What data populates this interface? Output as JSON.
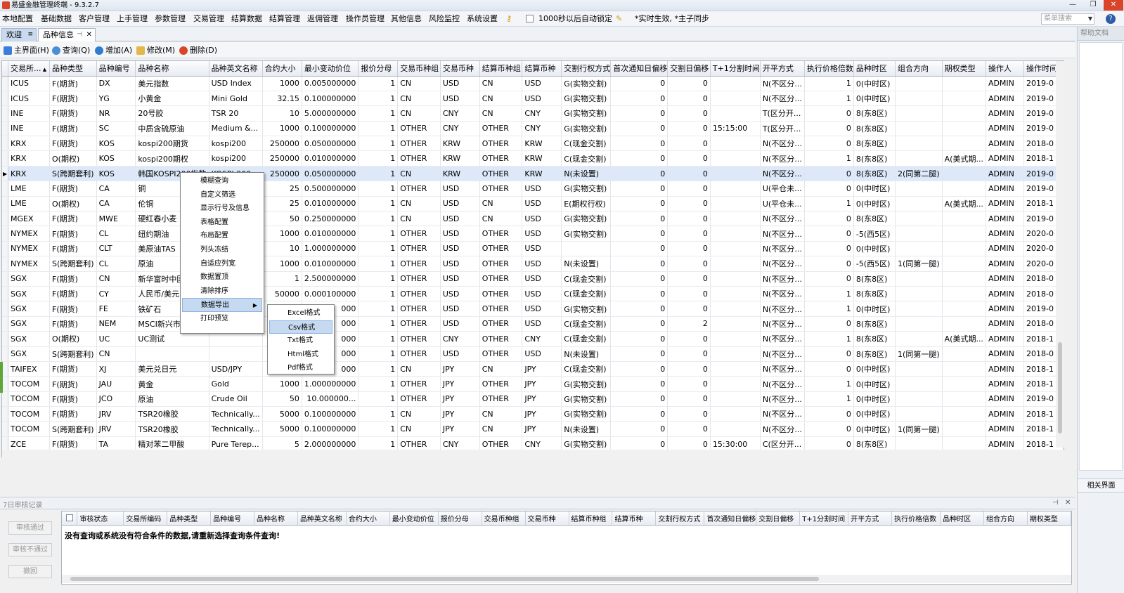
{
  "window": {
    "title": "易盛金融管理终端 - 9.3.2.7",
    "controls": [
      "—",
      "❐",
      "✕"
    ]
  },
  "menu": {
    "items": [
      "本地配置",
      "基础数据",
      "客户管理",
      "上手管理",
      "参数管理",
      "交易管理",
      "结算数据",
      "结算管理",
      "返佣管理",
      "操作员管理",
      "其他信息",
      "风险监控",
      "系统设置"
    ],
    "lock_label": "1000秒以后自动锁定",
    "notice": "*实时生效, *主子同步",
    "search_placeholder": "菜单搜索",
    "help": "?"
  },
  "tabs": [
    {
      "label": "欢迎"
    },
    {
      "label": "品种信息"
    }
  ],
  "toolbar": {
    "home": "主界面(H)",
    "query": "查询(Q)",
    "add": "增加(A)",
    "edit": "修改(M)",
    "delete": "删除(D)"
  },
  "grid": {
    "columns": [
      "交易所...",
      "品种类型",
      "品种编号",
      "品种名称",
      "品种英文名称",
      "合约大小",
      "最小变动价位",
      "报价分母",
      "交易币种组",
      "交易币种",
      "结算币种组",
      "结算币种",
      "交割行权方式",
      "首次通知日偏移",
      "交割日偏移",
      "T+1分割时间",
      "开平方式",
      "执行价格倍数",
      "品种时区",
      "组合方向",
      "期权类型",
      "操作人",
      "操作时间"
    ],
    "rows": [
      [
        "ICUS",
        "F(期货)",
        "DX",
        "美元指数",
        "USD Index",
        "1000",
        "0.005000000",
        "1",
        "CN",
        "USD",
        "CN",
        "USD",
        "G(实物交割)",
        "0",
        "0",
        "",
        "N(不区分...",
        "1",
        "0(中时区)",
        "",
        "",
        "ADMIN",
        "2019-0"
      ],
      [
        "ICUS",
        "F(期货)",
        "YG",
        "小黄金",
        "Mini Gold",
        "32.15",
        "0.100000000",
        "1",
        "CN",
        "USD",
        "CN",
        "USD",
        "G(实物交割)",
        "0",
        "0",
        "",
        "N(不区分...",
        "1",
        "0(中时区)",
        "",
        "",
        "ADMIN",
        "2019-0"
      ],
      [
        "INE",
        "F(期货)",
        "NR",
        "20号胶",
        "TSR 20",
        "10",
        "5.000000000",
        "1",
        "CN",
        "CNY",
        "CN",
        "CNY",
        "G(实物交割)",
        "0",
        "0",
        "",
        "T(区分开...",
        "0",
        "8(东8区)",
        "",
        "",
        "ADMIN",
        "2019-0"
      ],
      [
        "INE",
        "F(期货)",
        "SC",
        "中质含硫原油",
        "Medium &...",
        "1000",
        "0.100000000",
        "1",
        "OTHER",
        "CNY",
        "OTHER",
        "CNY",
        "G(实物交割)",
        "0",
        "0",
        "15:15:00",
        "T(区分开...",
        "0",
        "8(东8区)",
        "",
        "",
        "ADMIN",
        "2019-0"
      ],
      [
        "KRX",
        "F(期货)",
        "KOS",
        "kospi200期货",
        "kospi200",
        "250000",
        "0.050000000",
        "1",
        "OTHER",
        "KRW",
        "OTHER",
        "KRW",
        "C(现金交割)",
        "0",
        "0",
        "",
        "N(不区分...",
        "0",
        "8(东8区)",
        "",
        "",
        "ADMIN",
        "2018-0"
      ],
      [
        "KRX",
        "O(期权)",
        "KOS",
        "kospi200期权",
        "kospi200",
        "250000",
        "0.010000000",
        "1",
        "OTHER",
        "KRW",
        "OTHER",
        "KRW",
        "C(现金交割)",
        "0",
        "0",
        "",
        "N(不区分...",
        "1",
        "8(东8区)",
        "",
        "A(美式期...",
        "ADMIN",
        "2018-1"
      ],
      [
        "KRX",
        "S(跨期套利)",
        "KOS",
        "韩国KOSPI200指数",
        "KOSPI 200",
        "250000",
        "0.050000000",
        "1",
        "CN",
        "KRW",
        "OTHER",
        "KRW",
        "N(未设置)",
        "0",
        "0",
        "",
        "N(不区分...",
        "0",
        "8(东8区)",
        "2(同第二腿)",
        "",
        "ADMIN",
        "2019-0"
      ],
      [
        "LME",
        "F(期货)",
        "CA",
        "铜",
        "",
        "25",
        "0.500000000",
        "1",
        "OTHER",
        "USD",
        "OTHER",
        "USD",
        "G(实物交割)",
        "0",
        "0",
        "",
        "U(平仓未...",
        "0",
        "0(中时区)",
        "",
        "",
        "ADMIN",
        "2019-0"
      ],
      [
        "LME",
        "O(期权)",
        "CA",
        "伦铜",
        "",
        "25",
        "0.010000000",
        "1",
        "CN",
        "USD",
        "CN",
        "USD",
        "E(期权行权)",
        "0",
        "0",
        "",
        "U(平仓未...",
        "1",
        "0(中时区)",
        "",
        "A(美式期...",
        "ADMIN",
        "2018-1"
      ],
      [
        "MGEX",
        "F(期货)",
        "MWE",
        "硬红春小麦",
        "",
        "50",
        "0.250000000",
        "1",
        "CN",
        "USD",
        "CN",
        "USD",
        "G(实物交割)",
        "0",
        "0",
        "",
        "N(不区分...",
        "0",
        "8(东8区)",
        "",
        "",
        "ADMIN",
        "2019-0"
      ],
      [
        "NYMEX",
        "F(期货)",
        "CL",
        "纽约期油",
        "",
        "1000",
        "0.010000000",
        "1",
        "OTHER",
        "USD",
        "OTHER",
        "USD",
        "G(实物交割)",
        "0",
        "0",
        "",
        "N(不区分...",
        "0",
        "-5(西5区)",
        "",
        "",
        "ADMIN",
        "2020-0"
      ],
      [
        "NYMEX",
        "F(期货)",
        "CLT",
        "美原油TAS",
        "",
        "10",
        "1.000000000",
        "1",
        "OTHER",
        "USD",
        "OTHER",
        "USD",
        "",
        "0",
        "0",
        "",
        "N(不区分...",
        "0",
        "0(中时区)",
        "",
        "",
        "ADMIN",
        "2020-0"
      ],
      [
        "NYMEX",
        "S(跨期套利)",
        "CL",
        "原油",
        "",
        "1000",
        "0.010000000",
        "1",
        "OTHER",
        "USD",
        "OTHER",
        "USD",
        "N(未设置)",
        "0",
        "0",
        "",
        "N(不区分...",
        "0",
        "-5(西5区)",
        "1(同第一腿)",
        "",
        "ADMIN",
        "2020-0"
      ],
      [
        "SGX",
        "F(期货)",
        "CN",
        "新华富时中国",
        "",
        "1",
        "2.500000000",
        "1",
        "OTHER",
        "USD",
        "OTHER",
        "USD",
        "C(现金交割)",
        "0",
        "0",
        "",
        "N(不区分...",
        "0",
        "8(东8区)",
        "",
        "",
        "ADMIN",
        "2018-0"
      ],
      [
        "SGX",
        "F(期货)",
        "CY",
        "人民币/美元",
        "",
        "50000",
        "0.000100000",
        "1",
        "OTHER",
        "USD",
        "OTHER",
        "USD",
        "C(现金交割)",
        "0",
        "0",
        "",
        "N(不区分...",
        "1",
        "8(东8区)",
        "",
        "",
        "ADMIN",
        "2018-0"
      ],
      [
        "SGX",
        "F(期货)",
        "FE",
        "铁矿石",
        "",
        "",
        "000",
        "1",
        "OTHER",
        "USD",
        "OTHER",
        "USD",
        "G(实物交割)",
        "0",
        "0",
        "",
        "N(不区分...",
        "1",
        "0(中时区)",
        "",
        "",
        "ADMIN",
        "2019-0"
      ],
      [
        "SGX",
        "F(期货)",
        "NEM",
        "MSCI新兴市场",
        "",
        "",
        "000",
        "1",
        "OTHER",
        "USD",
        "OTHER",
        "USD",
        "C(现金交割)",
        "0",
        "2",
        "",
        "N(不区分...",
        "0",
        "8(东8区)",
        "",
        "",
        "ADMIN",
        "2018-0"
      ],
      [
        "SGX",
        "O(期权)",
        "UC",
        "UC测试",
        "",
        "",
        "000",
        "1",
        "OTHER",
        "CNY",
        "OTHER",
        "CNY",
        "C(现金交割)",
        "0",
        "0",
        "",
        "N(不区分...",
        "1",
        "8(东8区)",
        "",
        "A(美式期...",
        "ADMIN",
        "2018-1"
      ],
      [
        "SGX",
        "S(跨期套利)",
        "CN",
        "",
        "",
        "",
        "000",
        "1",
        "OTHER",
        "USD",
        "OTHER",
        "USD",
        "N(未设置)",
        "0",
        "0",
        "",
        "N(不区分...",
        "0",
        "8(东8区)",
        "1(同第一腿)",
        "",
        "ADMIN",
        "2018-0"
      ],
      [
        "TAIFEX",
        "F(期货)",
        "XJ",
        "美元兑日元",
        "USD/JPY",
        "",
        "000",
        "1",
        "CN",
        "JPY",
        "CN",
        "JPY",
        "C(现金交割)",
        "0",
        "0",
        "",
        "N(不区分...",
        "0",
        "0(中时区)",
        "",
        "",
        "ADMIN",
        "2018-1"
      ],
      [
        "TOCOM",
        "F(期货)",
        "JAU",
        "黄金",
        "Gold",
        "1000",
        "1.000000000",
        "1",
        "OTHER",
        "JPY",
        "OTHER",
        "JPY",
        "G(实物交割)",
        "0",
        "0",
        "",
        "N(不区分...",
        "1",
        "0(中时区)",
        "",
        "",
        "ADMIN",
        "2018-1"
      ],
      [
        "TOCOM",
        "F(期货)",
        "JCO",
        "原油",
        "Crude Oil",
        "50",
        "10.000000...",
        "1",
        "OTHER",
        "JPY",
        "OTHER",
        "JPY",
        "G(实物交割)",
        "0",
        "0",
        "",
        "N(不区分...",
        "1",
        "0(中时区)",
        "",
        "",
        "ADMIN",
        "2019-0"
      ],
      [
        "TOCOM",
        "F(期货)",
        "JRV",
        "TSR20橡胶",
        "Technically...",
        "5000",
        "0.100000000",
        "1",
        "CN",
        "JPY",
        "CN",
        "JPY",
        "G(实物交割)",
        "0",
        "0",
        "",
        "N(不区分...",
        "0",
        "0(中时区)",
        "",
        "",
        "ADMIN",
        "2018-1"
      ],
      [
        "TOCOM",
        "S(跨期套利)",
        "JRV",
        "TSR20橡胶",
        "Technically...",
        "5000",
        "0.100000000",
        "1",
        "CN",
        "JPY",
        "CN",
        "JPY",
        "N(未设置)",
        "0",
        "0",
        "",
        "N(不区分...",
        "0",
        "0(中时区)",
        "1(同第一腿)",
        "",
        "ADMIN",
        "2018-1"
      ],
      [
        "ZCE",
        "F(期货)",
        "TA",
        "精对苯二甲酸",
        "Pure Terep...",
        "5",
        "2.000000000",
        "1",
        "OTHER",
        "CNY",
        "OTHER",
        "CNY",
        "G(实物交割)",
        "0",
        "0",
        "15:30:00",
        "C(区分开...",
        "0",
        "8(东8区)",
        "",
        "",
        "ADMIN",
        "2018-1"
      ]
    ],
    "selected_row": 6
  },
  "context_menu": {
    "items": [
      "模糊查询",
      "自定义筛选",
      "显示行号及信息",
      "表格配置",
      "布局配置",
      "列头冻结",
      "自适应列宽",
      "数据置顶",
      "清除排序",
      "数据导出",
      "打印预览"
    ],
    "highlighted": "数据导出",
    "submenu": [
      "Excel格式",
      "Csv格式",
      "Txt格式",
      "Html格式",
      "Pdf格式"
    ],
    "submenu_highlighted": "Csv格式"
  },
  "side_panel": {
    "title": "帮助文档",
    "related": "相关界面"
  },
  "audit": {
    "title": "7日审核记录",
    "buttons": [
      "审核通过",
      "审核不通过",
      "撤回"
    ],
    "columns": [
      "审核状态",
      "交易所编码",
      "品种类型",
      "品种编号",
      "品种名称",
      "品种英文名称",
      "合约大小",
      "最小变动价位",
      "报价分母",
      "交易币种组",
      "交易币种",
      "结算币种组",
      "结算币种",
      "交割行权方式",
      "首次通知日偏移",
      "交割日偏移",
      "T+1分割时间",
      "开平方式",
      "执行价格倍数",
      "品种时区",
      "组合方向",
      "期权类型"
    ],
    "empty_message": "没有查询或系统没有符合条件的数据,请重新选择查询条件查询!"
  },
  "colors": {
    "selection": "#dde9f9",
    "menu_highlight": "#c5d9f1",
    "delete": "#d9452b",
    "accent": "#2c5da8"
  }
}
